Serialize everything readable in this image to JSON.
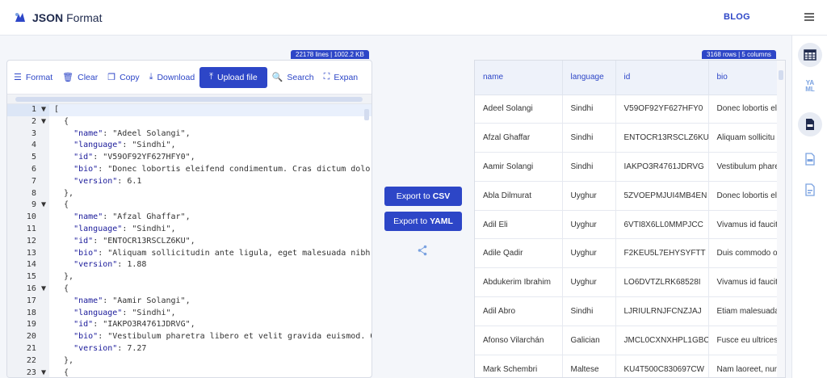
{
  "header": {
    "logo_bold": "JSON",
    "logo_light": "Format",
    "blog": "BLOG"
  },
  "editor": {
    "stats": "22178 lines | 1002.2 KB",
    "toolbar": [
      {
        "name": "format-button",
        "icon": "format-icon",
        "label": "Format"
      },
      {
        "name": "clear-button",
        "icon": "trash-icon",
        "label": "Clear"
      },
      {
        "name": "copy-button",
        "icon": "copy-icon",
        "label": "Copy"
      },
      {
        "name": "download-button",
        "icon": "download-icon",
        "label": "Download"
      },
      {
        "name": "upload-file-button",
        "icon": "upload-icon",
        "label": "Upload file",
        "primary": true
      },
      {
        "name": "search-button",
        "icon": "search-icon",
        "label": "Search"
      },
      {
        "name": "expand-button",
        "icon": "expand-icon",
        "label": "Expan"
      }
    ],
    "lines": [
      {
        "n": "1",
        "fold": true,
        "text": "[",
        "active": true
      },
      {
        "n": "2",
        "fold": true,
        "text": "  {"
      },
      {
        "n": "3",
        "k": "name",
        "v": "\"Adeel Solangi\","
      },
      {
        "n": "4",
        "k": "language",
        "v": "\"Sindhi\","
      },
      {
        "n": "5",
        "k": "id",
        "v": "\"V59OF92YF627HFY0\","
      },
      {
        "n": "6",
        "k": "bio",
        "v": "\"Donec lobortis eleifend condimentum. Cras dictum dolor la"
      },
      {
        "n": "7",
        "k": "version",
        "v": "6.1"
      },
      {
        "n": "8",
        "text": "  },"
      },
      {
        "n": "9",
        "fold": true,
        "text": "  {"
      },
      {
        "n": "10",
        "k": "name",
        "v": "\"Afzal Ghaffar\","
      },
      {
        "n": "11",
        "k": "language",
        "v": "\"Sindhi\","
      },
      {
        "n": "12",
        "k": "id",
        "v": "\"ENTOCR13RSCLZ6KU\","
      },
      {
        "n": "13",
        "k": "bio",
        "v": "\"Aliquam sollicitudin ante ligula, eget malesuada nibh ef"
      },
      {
        "n": "14",
        "k": "version",
        "v": "1.88"
      },
      {
        "n": "15",
        "text": "  },"
      },
      {
        "n": "16",
        "fold": true,
        "text": "  {"
      },
      {
        "n": "17",
        "k": "name",
        "v": "\"Aamir Solangi\","
      },
      {
        "n": "18",
        "k": "language",
        "v": "\"Sindhi\","
      },
      {
        "n": "19",
        "k": "id",
        "v": "\"IAKPO3R4761JDRVG\","
      },
      {
        "n": "20",
        "k": "bio",
        "v": "\"Vestibulum pharetra libero et velit gravida euismod. Qui"
      },
      {
        "n": "21",
        "k": "version",
        "v": "7.27"
      },
      {
        "n": "22",
        "text": "  },"
      },
      {
        "n": "23",
        "fold": true,
        "text": "  {"
      }
    ]
  },
  "actions": {
    "export_csv_prefix": "Export to",
    "export_csv_format": "CSV",
    "export_yaml_prefix": "Export to",
    "export_yaml_format": "YAML"
  },
  "table": {
    "stats": "3168 rows | 5 columns",
    "columns": [
      "name",
      "language",
      "id",
      "bio"
    ],
    "rows": [
      [
        "Adeel Solangi",
        "Sindhi",
        "V59OF92YF627HFY0",
        "Donec lobortis el"
      ],
      [
        "Afzal Ghaffar",
        "Sindhi",
        "ENTOCR13RSCLZ6KU",
        "Aliquam sollicitu"
      ],
      [
        "Aamir Solangi",
        "Sindhi",
        "IAKPO3R4761JDRVG",
        "Vestibulum phare"
      ],
      [
        "Abla Dilmurat",
        "Uyghur",
        "5ZVOEPMJUI4MB4EN",
        "Donec lobortis el"
      ],
      [
        "Adil Eli",
        "Uyghur",
        "6VTI8X6LL0MMPJCC",
        "Vivamus id faucit"
      ],
      [
        "Adile Qadir",
        "Uyghur",
        "F2KEU5L7EHYSYFTT",
        "Duis commodo o"
      ],
      [
        "Abdukerim Ibrahim",
        "Uyghur",
        "LO6DVTZLRK68528I",
        "Vivamus id faucit"
      ],
      [
        "Adil Abro",
        "Sindhi",
        "LJRIULRNJFCNZJAJ",
        "Etiam malesuada"
      ],
      [
        "Afonso Vilarchán",
        "Galician",
        "JMCL0CXNXHPL1GBC",
        "Fusce eu ultrices"
      ],
      [
        "Mark Schembri",
        "Maltese",
        "KU4T500C830697CW",
        "Nam laoreet, nur"
      ]
    ]
  },
  "sidebar": {
    "items": [
      {
        "name": "sidebar-table-view",
        "icon": "table-icon",
        "active": true
      },
      {
        "name": "sidebar-yaml-view",
        "icon": "yaml-icon",
        "label": "YA\nML"
      },
      {
        "name": "sidebar-json-view",
        "icon": "json-file-icon",
        "active": true
      },
      {
        "name": "sidebar-csv-view",
        "icon": "csv-file-icon"
      },
      {
        "name": "sidebar-xml-view",
        "icon": "file-icon"
      }
    ]
  },
  "colors": {
    "accent": "#2d46c7",
    "header_bg": "#ffffff",
    "page_bg": "#f4f6fa",
    "gutter_bg": "#f0f2f6"
  }
}
